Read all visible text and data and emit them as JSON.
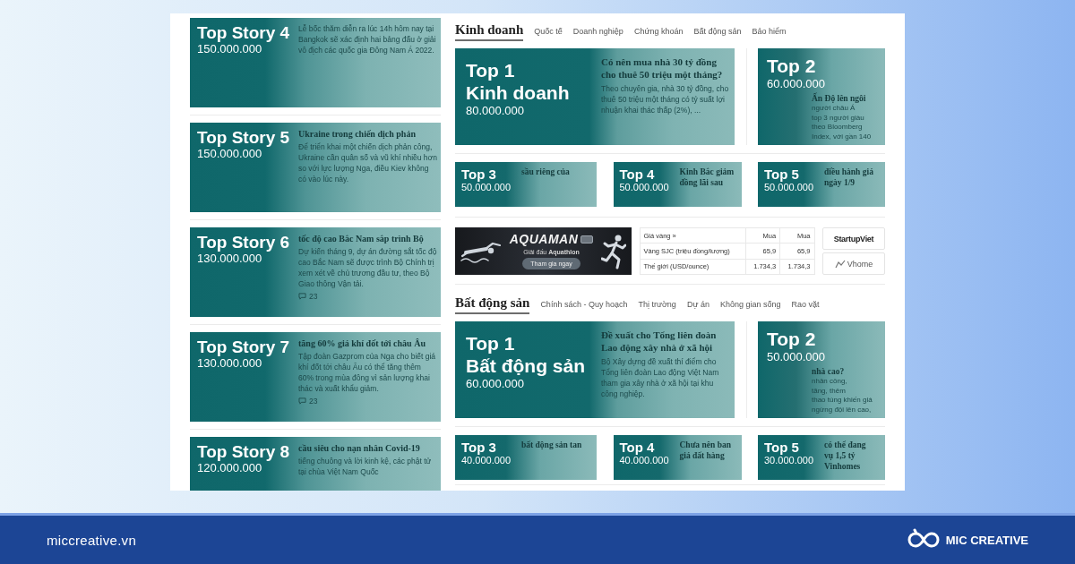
{
  "left_stories": [
    {
      "label": "Top Story 4",
      "price": "150.000.000",
      "lines": [
        {
          "kind": "snippet",
          "text": "Lễ bốc thăm diễn ra lúc 14h hôm nay tại Bangkok sẽ xác định hai bảng đấu ở giải vô địch các quốc gia Đông Nam Á 2022."
        }
      ]
    },
    {
      "label": "Top Story 5",
      "price": "150.000.000",
      "lines": [
        {
          "kind": "headline",
          "text": "Ukraine trong chiến dịch phản"
        },
        {
          "kind": "snippet",
          "text": "Để triển khai một chiến dịch phản công, Ukraine cần quân số và vũ khí nhiều hơn so với lực lượng Nga, điều Kiev không có vào lúc này."
        }
      ]
    },
    {
      "label": "Top Story 6",
      "price": "130.000.000",
      "lines": [
        {
          "kind": "headline",
          "text": "tốc độ cao Bắc Nam sắp trình Bộ"
        },
        {
          "kind": "snippet",
          "text": "Dự kiến tháng 9, dự án đường sắt tốc độ cao Bắc Nam sẽ được trình Bộ Chính trị xem xét về chủ trương đầu tư, theo Bộ Giao thông Vận tải."
        },
        {
          "kind": "comments",
          "text": "23"
        }
      ]
    },
    {
      "label": "Top Story 7",
      "price": "130.000.000",
      "lines": [
        {
          "kind": "headline",
          "text": "tăng 60% giá khí đốt tới châu Âu"
        },
        {
          "kind": "snippet",
          "text": "Tập đoàn Gazprom của Nga cho biết giá khí đốt tới châu Âu có thể tăng thêm 60% trong mùa đông vì sản lượng khai thác và xuất khẩu giảm."
        },
        {
          "kind": "comments",
          "text": "23"
        }
      ]
    },
    {
      "label": "Top Story 8",
      "price": "120.000.000",
      "lines": [
        {
          "kind": "headline",
          "text": "cầu siêu cho nạn nhân Covid-19"
        },
        {
          "kind": "snippet",
          "text": "tiếng chuông và lời kinh kệ, các phật tử tại chùa Việt Nam Quốc"
        }
      ]
    }
  ],
  "business_section": {
    "title": "Kinh doanh",
    "tabs": [
      "Quốc tế",
      "Doanh nghiệp",
      "Chứng khoán",
      "Bất động sản",
      "Bảo hiểm"
    ],
    "cards": [
      {
        "kind": "lead",
        "label": "Top 1",
        "category": "Kinh doanh",
        "price": "80.000.000",
        "lines": [
          {
            "kind": "headline",
            "text": "Có nên mua nhà 30 tỷ đồng cho thuê 50 triệu một tháng?"
          },
          {
            "kind": "snippet",
            "text": "Theo chuyên gia, nhà 30 tỷ đồng, cho thuê 50 triệu một tháng có tỷ suất lợi nhuận khai thác thấp (2%), ..."
          }
        ]
      },
      {
        "kind": "side",
        "label": "Top 2",
        "price": "60.000.000",
        "lines": [
          {
            "kind": "headline",
            "text": "Ấn Độ lên ngôi"
          },
          {
            "kind": "snippet",
            "text": "người châu Á"
          },
          {
            "kind": "snippet",
            "text": "top 3 người giàu"
          },
          {
            "kind": "snippet",
            "text": "theo Bloomberg"
          },
          {
            "kind": "snippet",
            "text": "Index, với gần 140"
          }
        ]
      },
      {
        "kind": "small",
        "label": "Top 3",
        "price": "50.000.000",
        "lines": [
          {
            "kind": "headline",
            "text": "sầu riêng của"
          }
        ]
      },
      {
        "kind": "small",
        "label": "Top 4",
        "price": "50.000.000",
        "lines": [
          {
            "kind": "headline",
            "text": "Kinh Bắc giảm"
          },
          {
            "kind": "headline",
            "text": "đồng lãi sau"
          }
        ]
      },
      {
        "kind": "small",
        "label": "Top 5",
        "price": "50.000.000",
        "lines": [
          {
            "kind": "headline",
            "text": "điều hành giá"
          },
          {
            "kind": "headline",
            "text": "ngày 1/9"
          }
        ]
      }
    ]
  },
  "promo_row": {
    "ad_banner": {
      "title": "AQUAMAN",
      "subtitle": "Giải đấu **Aquathlon**",
      "button": "Tham gia ngay"
    },
    "gold_table": {
      "title": "Giá vàng »",
      "columns": [
        "Mua",
        "Mua"
      ],
      "rows": [
        {
          "label": "Vàng SJC (triệu đồng/lượng)",
          "values": [
            "65,9",
            "65,9"
          ]
        },
        {
          "label": "Thế giới (USD/ounce)",
          "values": [
            "1.734,3",
            "1.734,3"
          ]
        }
      ]
    },
    "partner_logos": [
      {
        "kind": "startup",
        "name": "StartupViet"
      },
      {
        "kind": "vhome",
        "name": "Vhome"
      }
    ]
  },
  "real_estate_section": {
    "title": "Bất động sản",
    "tabs": [
      "Chính sách - Quy hoạch",
      "Thị trường",
      "Dự án",
      "Không gian sống",
      "Rao vặt"
    ],
    "cards": [
      {
        "kind": "lead",
        "label": "Top 1",
        "category": "Bất động sản",
        "price": "60.000.000",
        "lines": [
          {
            "kind": "headline",
            "text": "Đề xuất cho Tổng liên đoàn Lao động xây nhà ở xã hội"
          },
          {
            "kind": "snippet",
            "text": "Bộ Xây dựng đề xuất thí điểm cho Tổng liên đoàn Lao động Việt Nam tham gia xây nhà ở xã hội tại khu công nghiệp."
          }
        ]
      },
      {
        "kind": "side",
        "label": "Top 2",
        "price": "50.000.000",
        "lines": [
          {
            "kind": "headline",
            "text": "nhà cao?"
          },
          {
            "kind": "snippet",
            "text": "nhân công,"
          },
          {
            "kind": "snippet",
            "text": "tăng, thêm"
          },
          {
            "kind": "snippet",
            "text": "thao túng khiến giá"
          },
          {
            "kind": "snippet",
            "text": "ngừng đội lên cao,"
          }
        ]
      },
      {
        "kind": "small",
        "label": "Top 3",
        "price": "40.000.000",
        "lines": [
          {
            "kind": "headline",
            "text": "bất động sản tan"
          }
        ]
      },
      {
        "kind": "small",
        "label": "Top 4",
        "price": "40.000.000",
        "lines": [
          {
            "kind": "headline",
            "text": "Chưa nên ban"
          },
          {
            "kind": "headline",
            "text": "giá đất hàng"
          }
        ]
      },
      {
        "kind": "small",
        "label": "Top 5",
        "price": "30.000.000",
        "lines": [
          {
            "kind": "headline",
            "text": "có thể đang"
          },
          {
            "kind": "headline",
            "text": "vụ 1,5 tỷ"
          },
          {
            "kind": "headline",
            "text": "Vinhomes"
          }
        ]
      }
    ]
  },
  "footer": {
    "website": "miccreative.vn",
    "brand": "MIC CREATIVE"
  }
}
